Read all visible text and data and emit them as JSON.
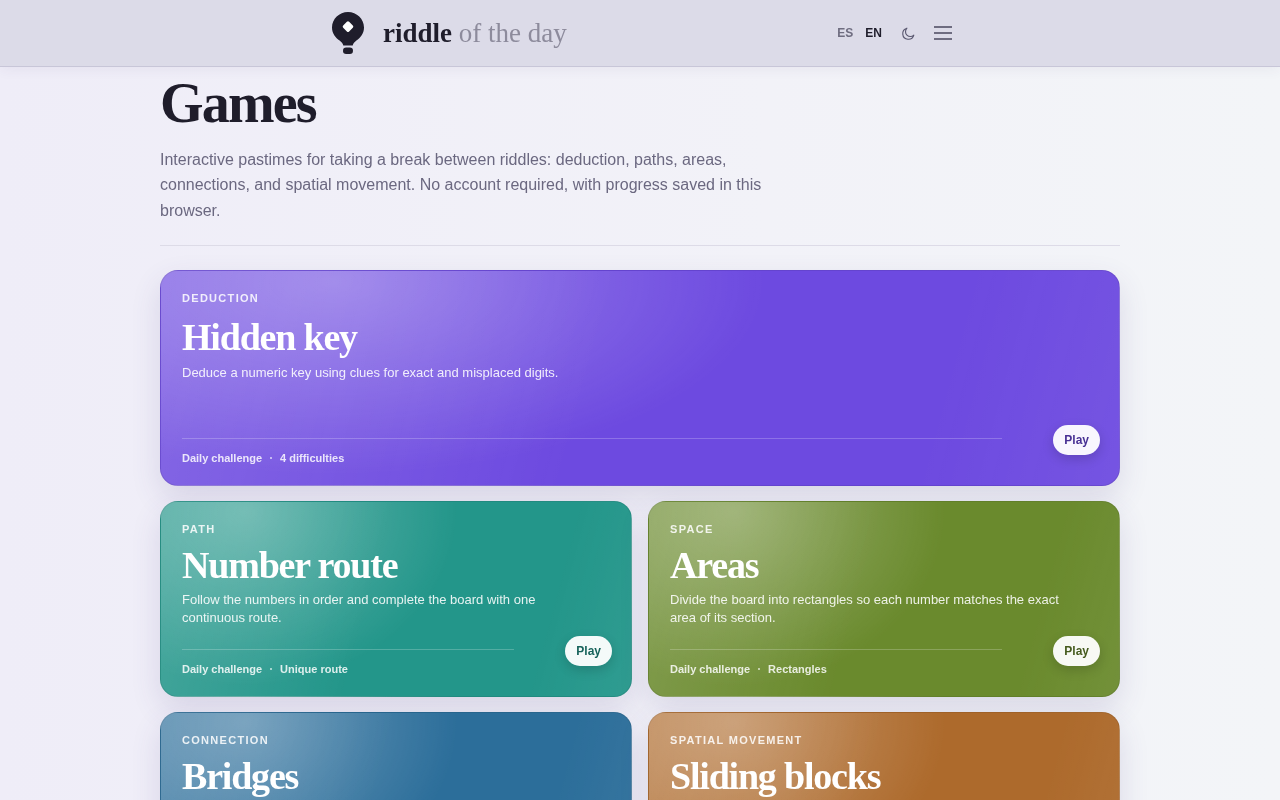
{
  "header": {
    "site_title": "**riddle** of the day",
    "languages": [
      {
        "label": "ES",
        "selected": false
      },
      {
        "label": "EN",
        "selected": true
      }
    ]
  },
  "page": {
    "title": "Games",
    "intro": "Interactive pastimes for taking a break between riddles: deduction, paths, areas, connections, and spatial movement. No account required, with progress saved in this browser."
  },
  "games": [
    {
      "category": "DEDUCTION",
      "title": "Hidden key",
      "description": "Deduce a numeric key using clues for exact and misplaced digits.",
      "tags": [
        "Daily challenge",
        "4 difficulties"
      ],
      "action": "Play",
      "color": "#6d4ae0",
      "featured": true
    },
    {
      "category": "PATH",
      "title": "Number route",
      "description": "Follow the numbers in order and complete the board with one continuous route.",
      "tags": [
        "Daily challenge",
        "Unique route"
      ],
      "action": "Play",
      "color": "#23968a",
      "featured": false
    },
    {
      "category": "SPACE",
      "title": "Areas",
      "description": "Divide the board into rectangles so each number matches the exact area of its section.",
      "tags": [
        "Daily challenge",
        "Rectangles"
      ],
      "action": "Play",
      "color": "#6a8a2d",
      "featured": false
    },
    {
      "category": "CONNECTION",
      "title": "Bridges",
      "color": "#2c6e9a",
      "featured": false
    },
    {
      "category": "SPATIAL MOVEMENT",
      "title": "Sliding blocks",
      "color": "#ad6a2c",
      "featured": false
    }
  ]
}
